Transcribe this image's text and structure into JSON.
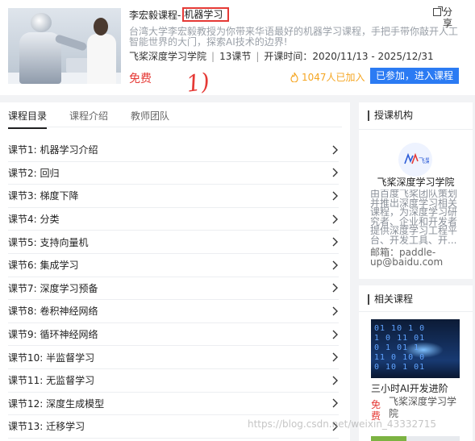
{
  "header": {
    "title_main": "李宏毅课程-",
    "title_sub": "机器学习",
    "share_label": "分享",
    "description": "台湾大学李宏毅教授为你带来华语最好的机器学习课程，手把手带你敲开人工智能世界的大门，探索AI技术的边界!",
    "org": "飞桨深度学习学院",
    "lessons_count": "13课节",
    "period": "开课时间：2020/11/13 - 2025/12/31",
    "price": "免费",
    "annotation": "1)",
    "joined": "1047人已加入",
    "enter_button": "已参加，进入课程"
  },
  "tabs": [
    "课程目录",
    "课程介绍",
    "教师团队"
  ],
  "lessons": [
    "课节1: 机器学习介绍",
    "课节2: 回归",
    "课节3: 梯度下降",
    "课节4: 分类",
    "课节5: 支持向量机",
    "课节6: 集成学习",
    "课节7: 深度学习预备",
    "课节8: 卷积神经网络",
    "课节9: 循环神经网络",
    "课节10: 半监督学习",
    "课节11: 无监督学习",
    "课节12: 深度生成模型",
    "课节13: 迁移学习"
  ],
  "sidebar": {
    "org_section_title": "授课机构",
    "org_logo_text": "飞桨",
    "org_name": "飞桨深度学习学院",
    "org_desc": "由百度飞桨团队策划并推出深度学习相关课程，为深度学习研究者、企业和开发者提供深度学习工程平台、开发工具、开...",
    "org_email": "邮箱：paddle-up@baidu.com",
    "related_section_title": "相关课程",
    "related_title": "三小时AI开发进阶",
    "related_price": "免费",
    "related_org": "飞桨深度学习学院"
  },
  "watermark": "https://blog.csdn.net/weixin_43332715",
  "colors": {
    "accent": "#2b7bf3",
    "price": "#e53935",
    "joined": "#f5a623"
  }
}
